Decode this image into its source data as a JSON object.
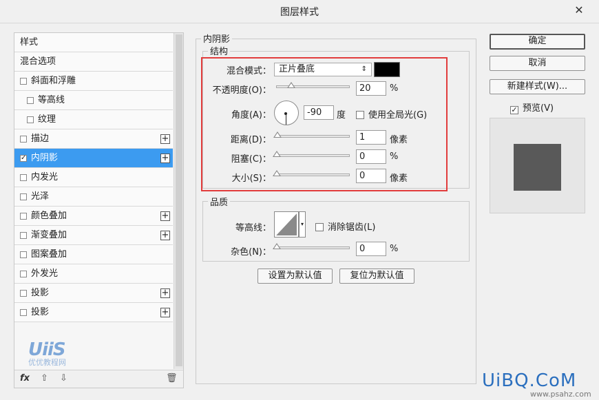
{
  "window": {
    "title": "图层样式",
    "close": "✕"
  },
  "styles_list": [
    {
      "label": "样式",
      "checkbox": false,
      "plus": false,
      "indent": 0
    },
    {
      "label": "混合选项",
      "checkbox": false,
      "plus": false,
      "indent": 0
    },
    {
      "label": "斜面和浮雕",
      "checkbox": true,
      "checked": false,
      "plus": false,
      "indent": 0
    },
    {
      "label": "等高线",
      "checkbox": true,
      "checked": false,
      "plus": false,
      "indent": 1
    },
    {
      "label": "纹理",
      "checkbox": true,
      "checked": false,
      "plus": false,
      "indent": 1
    },
    {
      "label": "描边",
      "checkbox": true,
      "checked": false,
      "plus": true,
      "indent": 0
    },
    {
      "label": "内阴影",
      "checkbox": true,
      "checked": true,
      "plus": true,
      "indent": 0,
      "selected": true
    },
    {
      "label": "内发光",
      "checkbox": true,
      "checked": false,
      "plus": false,
      "indent": 0
    },
    {
      "label": "光泽",
      "checkbox": true,
      "checked": false,
      "plus": false,
      "indent": 0
    },
    {
      "label": "颜色叠加",
      "checkbox": true,
      "checked": false,
      "plus": true,
      "indent": 0
    },
    {
      "label": "渐变叠加",
      "checkbox": true,
      "checked": false,
      "plus": true,
      "indent": 0
    },
    {
      "label": "图案叠加",
      "checkbox": true,
      "checked": false,
      "plus": false,
      "indent": 0
    },
    {
      "label": "外发光",
      "checkbox": true,
      "checked": false,
      "plus": false,
      "indent": 0
    },
    {
      "label": "投影",
      "checkbox": true,
      "checked": false,
      "plus": true,
      "indent": 0
    },
    {
      "label": "投影",
      "checkbox": true,
      "checked": false,
      "plus": true,
      "indent": 0
    }
  ],
  "left_footer": {
    "fx": "fx",
    "up": "⇧",
    "down": "⇩",
    "trash": "🗑"
  },
  "watermark": {
    "logo": "UiiS",
    "sub": "优优教程网"
  },
  "inner_shadow": {
    "section_title": "内阴影",
    "structure_title": "结构",
    "blend_mode_label": "混合模式：",
    "blend_mode_value": "正片叠底",
    "shadow_color": "#000000",
    "opacity_label": "不透明度(O)：",
    "opacity_value": "20",
    "opacity_unit": "%",
    "opacity_level": 20,
    "angle_label": "角度(A)：",
    "angle_value": "-90",
    "angle_unit": "度",
    "global_light_label": "使用全局光(G)",
    "distance_label": "距离(D)：",
    "distance_value": "1",
    "distance_unit": "像素",
    "distance_level": 1,
    "choke_label": "阻塞(C)：",
    "choke_value": "0",
    "choke_unit": "%",
    "size_label": "大小(S)：",
    "size_value": "0",
    "size_unit": "像素",
    "quality_title": "品质",
    "contour_label": "等高线：",
    "antialias_label": "消除锯齿(L)",
    "noise_label": "杂色(N)：",
    "noise_value": "0",
    "noise_unit": "%",
    "set_default_label": "设置为默认值",
    "reset_default_label": "复位为默认值"
  },
  "right_buttons": {
    "ok": "确定",
    "cancel": "取消",
    "new_style": "新建样式(W)...",
    "preview_label": "预览(V)",
    "preview_checked": true,
    "preview_swatch_color": "#595959"
  },
  "site_watermark": {
    "main": "UiBQ.CoM",
    "sub": "www.psahz.com"
  },
  "colors": {
    "selection": "#3c9bf0",
    "highlight": "#e23b3b"
  }
}
